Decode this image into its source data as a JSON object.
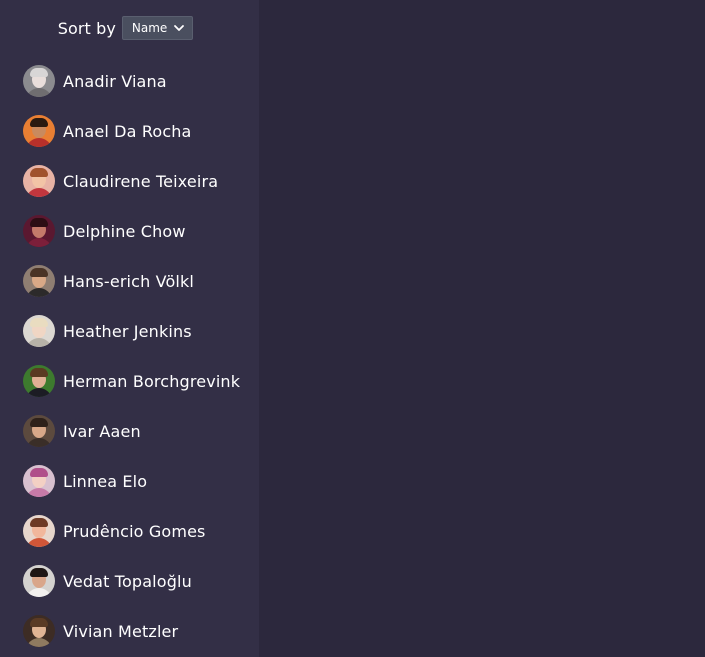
{
  "sort": {
    "label": "Sort by",
    "selected": "Name",
    "chevron_icon": "chevron-down-icon"
  },
  "contacts": [
    {
      "name": "Anadir Viana",
      "avatar": {
        "bg": "#8b8b8f",
        "skin": "#e9dedb",
        "hair": "#d8d6d6",
        "shirt": "#6f6d70"
      }
    },
    {
      "name": "Anael Da Rocha",
      "avatar": {
        "bg": "#e97f33",
        "skin": "#c98a5e",
        "hair": "#2a1a10",
        "shirt": "#b8302a"
      }
    },
    {
      "name": "Claudirene Teixeira",
      "avatar": {
        "bg": "#e8b3a5",
        "skin": "#f2c4a6",
        "hair": "#a0522d",
        "shirt": "#c2363e"
      }
    },
    {
      "name": "Delphine Chow",
      "avatar": {
        "bg": "#5a1830",
        "skin": "#c47a6a",
        "hair": "#2c0e14",
        "shirt": "#7c1f3a"
      }
    },
    {
      "name": "Hans-erich Völkl",
      "avatar": {
        "bg": "#8f7e72",
        "skin": "#d9a987",
        "hair": "#4a3426",
        "shirt": "#2c2a2a"
      }
    },
    {
      "name": "Heather Jenkins",
      "avatar": {
        "bg": "#dcd8d2",
        "skin": "#f0d6c4",
        "hair": "#e9dcc0",
        "shirt": "#b7b2a8"
      }
    },
    {
      "name": "Herman Borchgrevink",
      "avatar": {
        "bg": "#3d7a2e",
        "skin": "#e0b095",
        "hair": "#5a3a22",
        "shirt": "#1c1c24"
      }
    },
    {
      "name": "Ivar Aaen",
      "avatar": {
        "bg": "#5c4a3e",
        "skin": "#d8a889",
        "hair": "#2e211a",
        "shirt": "#3a2e28"
      }
    },
    {
      "name": "Linnea Elo",
      "avatar": {
        "bg": "#d8c0cf",
        "skin": "#f3d0c4",
        "hair": "#b04f8a",
        "shirt": "#c77aa8"
      }
    },
    {
      "name": "Prudêncio Gomes",
      "avatar": {
        "bg": "#e7d6cc",
        "skin": "#f1b79c",
        "hair": "#6d3a25",
        "shirt": "#d15638"
      }
    },
    {
      "name": "Vedat Topaloğlu",
      "avatar": {
        "bg": "#d4d2cf",
        "skin": "#d9a68a",
        "hair": "#1e1614",
        "shirt": "#f2f0ee"
      }
    },
    {
      "name": "Vivian Metzler",
      "avatar": {
        "bg": "#3d2c24",
        "skin": "#e0b494",
        "hair": "#5a3b25",
        "shirt": "#8f7a60"
      }
    }
  ]
}
